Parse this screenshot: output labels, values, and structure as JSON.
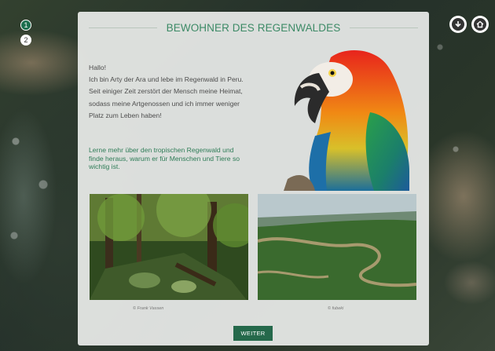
{
  "steps": [
    {
      "label": "1",
      "state": "active"
    },
    {
      "label": "2",
      "state": "inactive"
    }
  ],
  "top_icons": [
    "download-icon",
    "home-icon"
  ],
  "panel": {
    "title": "BEWOHNER DES REGENWALDES",
    "greeting": "Hallo!",
    "intro": "Ich bin Arty der Ara und lebe im Regenwald in Peru. Seit einiger Zeit zerstört der Mensch meine Heimat, sodass meine Artgenossen und ich immer weniger Platz zum Leben haben!",
    "learn_more": "Lerne mehr über den tropischen Regenwald und finde heraus, warum er für Menschen und Tiere so wichtig ist.",
    "caption_left": "© Frank Vassen",
    "caption_right": "© fubeki",
    "next_button": "WEITER"
  },
  "colors": {
    "accent": "#3c8a66",
    "button": "#25694b",
    "panel_bg": "#eaece9"
  }
}
